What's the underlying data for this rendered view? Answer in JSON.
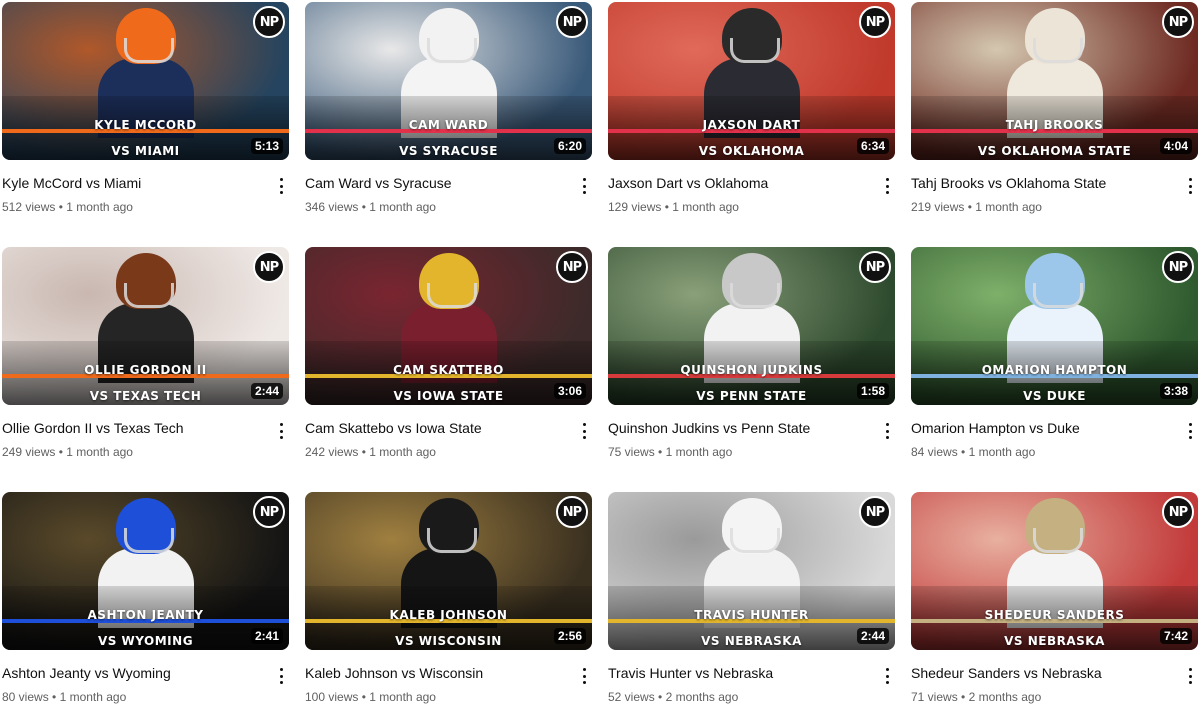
{
  "videos": [
    {
      "title": "Kyle McCord vs Miami",
      "thumb_line1": "KYLE MCCORD",
      "thumb_line2": "VS MIAMI",
      "duration": "5:13",
      "views": "512 views",
      "age": "1 month ago",
      "logo": "NP",
      "colors": {
        "bg1": "#24445f",
        "bg2": "#b0582a",
        "helmet": "#f06a1c",
        "jersey": "#1c2e5a",
        "accent": "#f06a1c"
      }
    },
    {
      "title": "Cam Ward vs Syracuse",
      "thumb_line1": "CAM WARD",
      "thumb_line2": "VS SYRACUSE",
      "duration": "6:20",
      "views": "346 views",
      "age": "1 month ago",
      "logo": "NP",
      "colors": {
        "bg1": "#3a5a7a",
        "bg2": "#e8e8e8",
        "helmet": "#f2f2f2",
        "jersey": "#f4f4f4",
        "accent": "#e2314b"
      }
    },
    {
      "title": "Jaxson Dart vs Oklahoma",
      "thumb_line1": "JAXSON DART",
      "thumb_line2": "VS OKLAHOMA",
      "duration": "6:34",
      "views": "129 views",
      "age": "1 month ago",
      "logo": "NP",
      "colors": {
        "bg1": "#c0392b",
        "bg2": "#e06a5a",
        "helmet": "#2a2a2a",
        "jersey": "#2b2b33",
        "accent": "#e2314b"
      }
    },
    {
      "title": "Tahj Brooks vs Oklahoma State",
      "thumb_line1": "TAHJ BROOKS",
      "thumb_line2": "VS OKLAHOMA STATE",
      "duration": "4:04",
      "views": "219 views",
      "age": "1 month ago",
      "logo": "NP",
      "colors": {
        "bg1": "#6e2a22",
        "bg2": "#d4c7b0",
        "helmet": "#ece4d6",
        "jersey": "#efe8dc",
        "accent": "#e2314b"
      }
    },
    {
      "title": "Ollie Gordon II vs Texas Tech",
      "thumb_line1": "OLLIE GORDON II",
      "thumb_line2": "VS TEXAS TECH",
      "duration": "2:44",
      "views": "249 views",
      "age": "1 month ago",
      "logo": "NP",
      "colors": {
        "bg1": "#efe9e6",
        "bg2": "#c9b7b0",
        "helmet": "#7a3a1a",
        "jersey": "#252525",
        "accent": "#f06a1c"
      }
    },
    {
      "title": "Cam Skattebo vs Iowa State",
      "thumb_line1": "CAM SKATTEBO",
      "thumb_line2": "VS IOWA STATE",
      "duration": "3:06",
      "views": "242 views",
      "age": "1 month ago",
      "logo": "NP",
      "colors": {
        "bg1": "#3c2a2a",
        "bg2": "#7a2530",
        "helmet": "#e3b52c",
        "jersey": "#7a1f2e",
        "accent": "#e3b52c"
      }
    },
    {
      "title": "Quinshon Judkins vs Penn State",
      "thumb_line1": "QUINSHON JUDKINS",
      "thumb_line2": "VS PENN STATE",
      "duration": "1:58",
      "views": "75 views",
      "age": "1 month ago",
      "logo": "NP",
      "colors": {
        "bg1": "#2e4a2e",
        "bg2": "#8aa07a",
        "helmet": "#c8c8c8",
        "jersey": "#f2f2f2",
        "accent": "#d63a3a"
      }
    },
    {
      "title": "Omarion Hampton vs Duke",
      "thumb_line1": "OMARION HAMPTON",
      "thumb_line2": "VS DUKE",
      "duration": "3:38",
      "views": "84 views",
      "age": "1 month ago",
      "logo": "NP",
      "colors": {
        "bg1": "#2f5a2f",
        "bg2": "#7fb06a",
        "helmet": "#9cc7ea",
        "jersey": "#eaf3fb",
        "accent": "#7fb2e0"
      }
    },
    {
      "title": "Ashton Jeanty vs Wyoming",
      "thumb_line1": "ASHTON JEANTY",
      "thumb_line2": "VS WYOMING",
      "duration": "2:41",
      "views": "80 views",
      "age": "1 month ago",
      "logo": "NP",
      "colors": {
        "bg1": "#141414",
        "bg2": "#5a4a2a",
        "helmet": "#1e4fd8",
        "jersey": "#f2f2f2",
        "accent": "#1e4fd8"
      }
    },
    {
      "title": "Kaleb Johnson vs Wisconsin",
      "thumb_line1": "KALEB JOHNSON",
      "thumb_line2": "VS WISCONSIN",
      "duration": "2:56",
      "views": "100 views",
      "age": "1 month ago",
      "logo": "NP",
      "colors": {
        "bg1": "#3a3020",
        "bg2": "#a08040",
        "helmet": "#1a1a1a",
        "jersey": "#151515",
        "accent": "#e3b52c"
      }
    },
    {
      "title": "Travis Hunter vs Nebraska",
      "thumb_line1": "TRAVIS HUNTER",
      "thumb_line2": "VS NEBRASKA",
      "duration": "2:44",
      "views": "52 views",
      "age": "2 months ago",
      "logo": "NP",
      "colors": {
        "bg1": "#d9d9d9",
        "bg2": "#9a9a9a",
        "helmet": "#f4f4f4",
        "jersey": "#f2f2f2",
        "accent": "#e2b52c"
      }
    },
    {
      "title": "Shedeur Sanders vs Nebraska",
      "thumb_line1": "SHEDEUR SANDERS",
      "thumb_line2": "VS NEBRASKA",
      "duration": "7:42",
      "views": "71 views",
      "age": "2 months ago",
      "logo": "NP",
      "colors": {
        "bg1": "#c23a3a",
        "bg2": "#e8b0a0",
        "helmet": "#c4b080",
        "jersey": "#f4f4f4",
        "accent": "#c4b080"
      }
    }
  ]
}
